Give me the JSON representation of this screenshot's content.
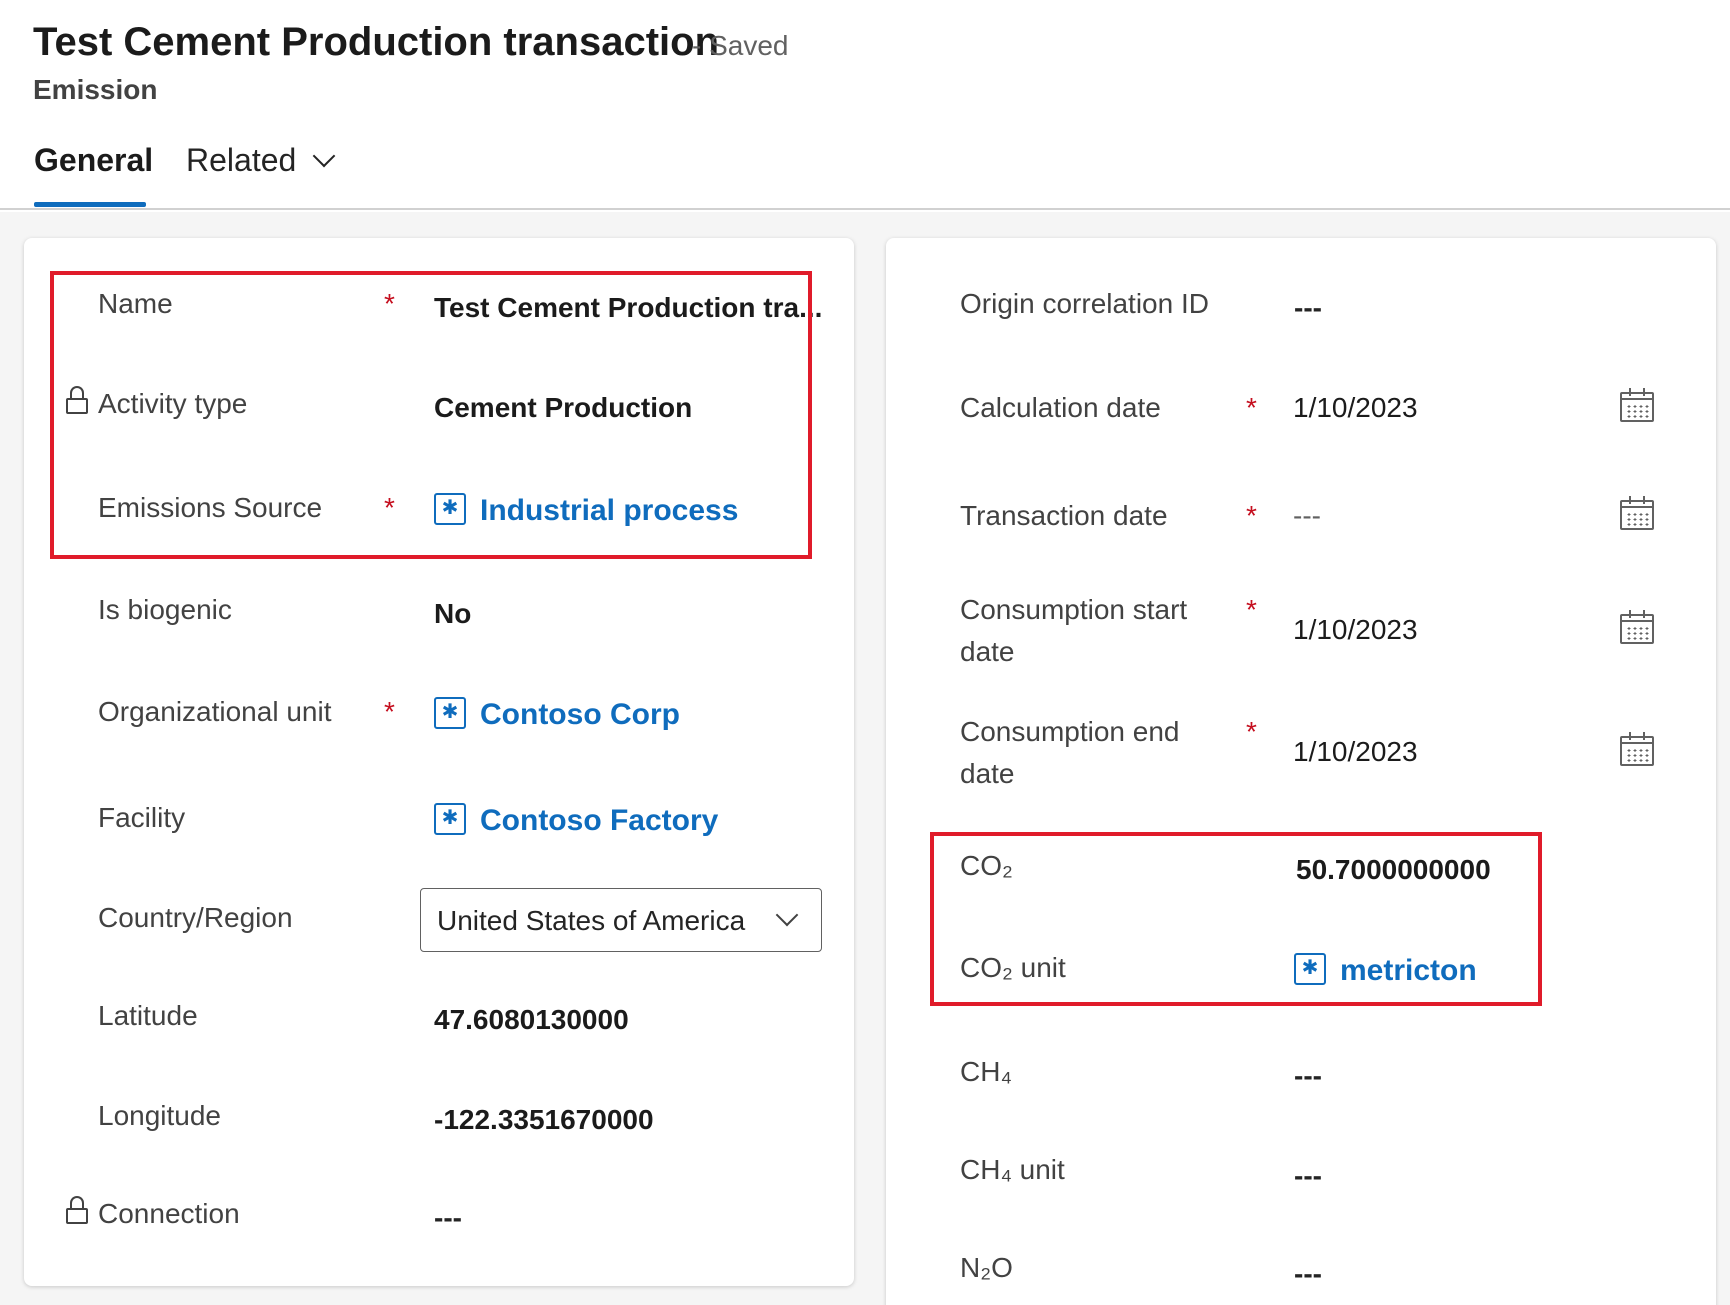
{
  "header": {
    "title": "Test Cement Production transaction",
    "saved_status": "- Saved",
    "entity_type": "Emission"
  },
  "tabs": {
    "general": "General",
    "related": "Related"
  },
  "left_fields": {
    "name": {
      "label": "Name",
      "required": "*",
      "value": "Test Cement Production tra..."
    },
    "activity_type": {
      "label": "Activity type",
      "value": "Cement Production"
    },
    "emissions_source": {
      "label": "Emissions Source",
      "required": "*",
      "value": "Industrial process"
    },
    "is_biogenic": {
      "label": "Is biogenic",
      "value": "No"
    },
    "organizational_unit": {
      "label": "Organizational unit",
      "required": "*",
      "value": "Contoso Corp"
    },
    "facility": {
      "label": "Facility",
      "value": "Contoso Factory"
    },
    "country_region": {
      "label": "Country/Region",
      "value": "United States of America"
    },
    "latitude": {
      "label": "Latitude",
      "value": "47.6080130000"
    },
    "longitude": {
      "label": "Longitude",
      "value": "-122.3351670000"
    },
    "connection": {
      "label": "Connection",
      "value": "---"
    }
  },
  "right_fields": {
    "origin_correlation_id": {
      "label": "Origin correlation ID",
      "value": "---"
    },
    "calculation_date": {
      "label": "Calculation date",
      "required": "*",
      "value": "1/10/2023"
    },
    "transaction_date": {
      "label": "Transaction date",
      "required": "*",
      "value": "---"
    },
    "consumption_start_date": {
      "label_line1": "Consumption start",
      "label_line2": "date",
      "required": "*",
      "value": "1/10/2023"
    },
    "consumption_end_date": {
      "label_line1": "Consumption end",
      "label_line2": "date",
      "required": "*",
      "value": "1/10/2023"
    },
    "co2": {
      "label": "CO₂",
      "value": "50.7000000000"
    },
    "co2_unit": {
      "label": "CO₂ unit",
      "value": "metricton"
    },
    "ch4": {
      "label": "CH₄",
      "value": "---"
    },
    "ch4_unit": {
      "label": "CH₄ unit",
      "value": "---"
    },
    "n2o": {
      "label": "N₂O",
      "value": "---"
    }
  },
  "colors": {
    "accent": "#0f6cbd",
    "highlight_box": "#e01b2a",
    "required": "#c50f1f"
  },
  "icons": {
    "lookup": "entity-lookup-icon",
    "lock": "lock-icon",
    "calendar": "calendar-icon",
    "dropdown": "chevron-down-icon"
  }
}
